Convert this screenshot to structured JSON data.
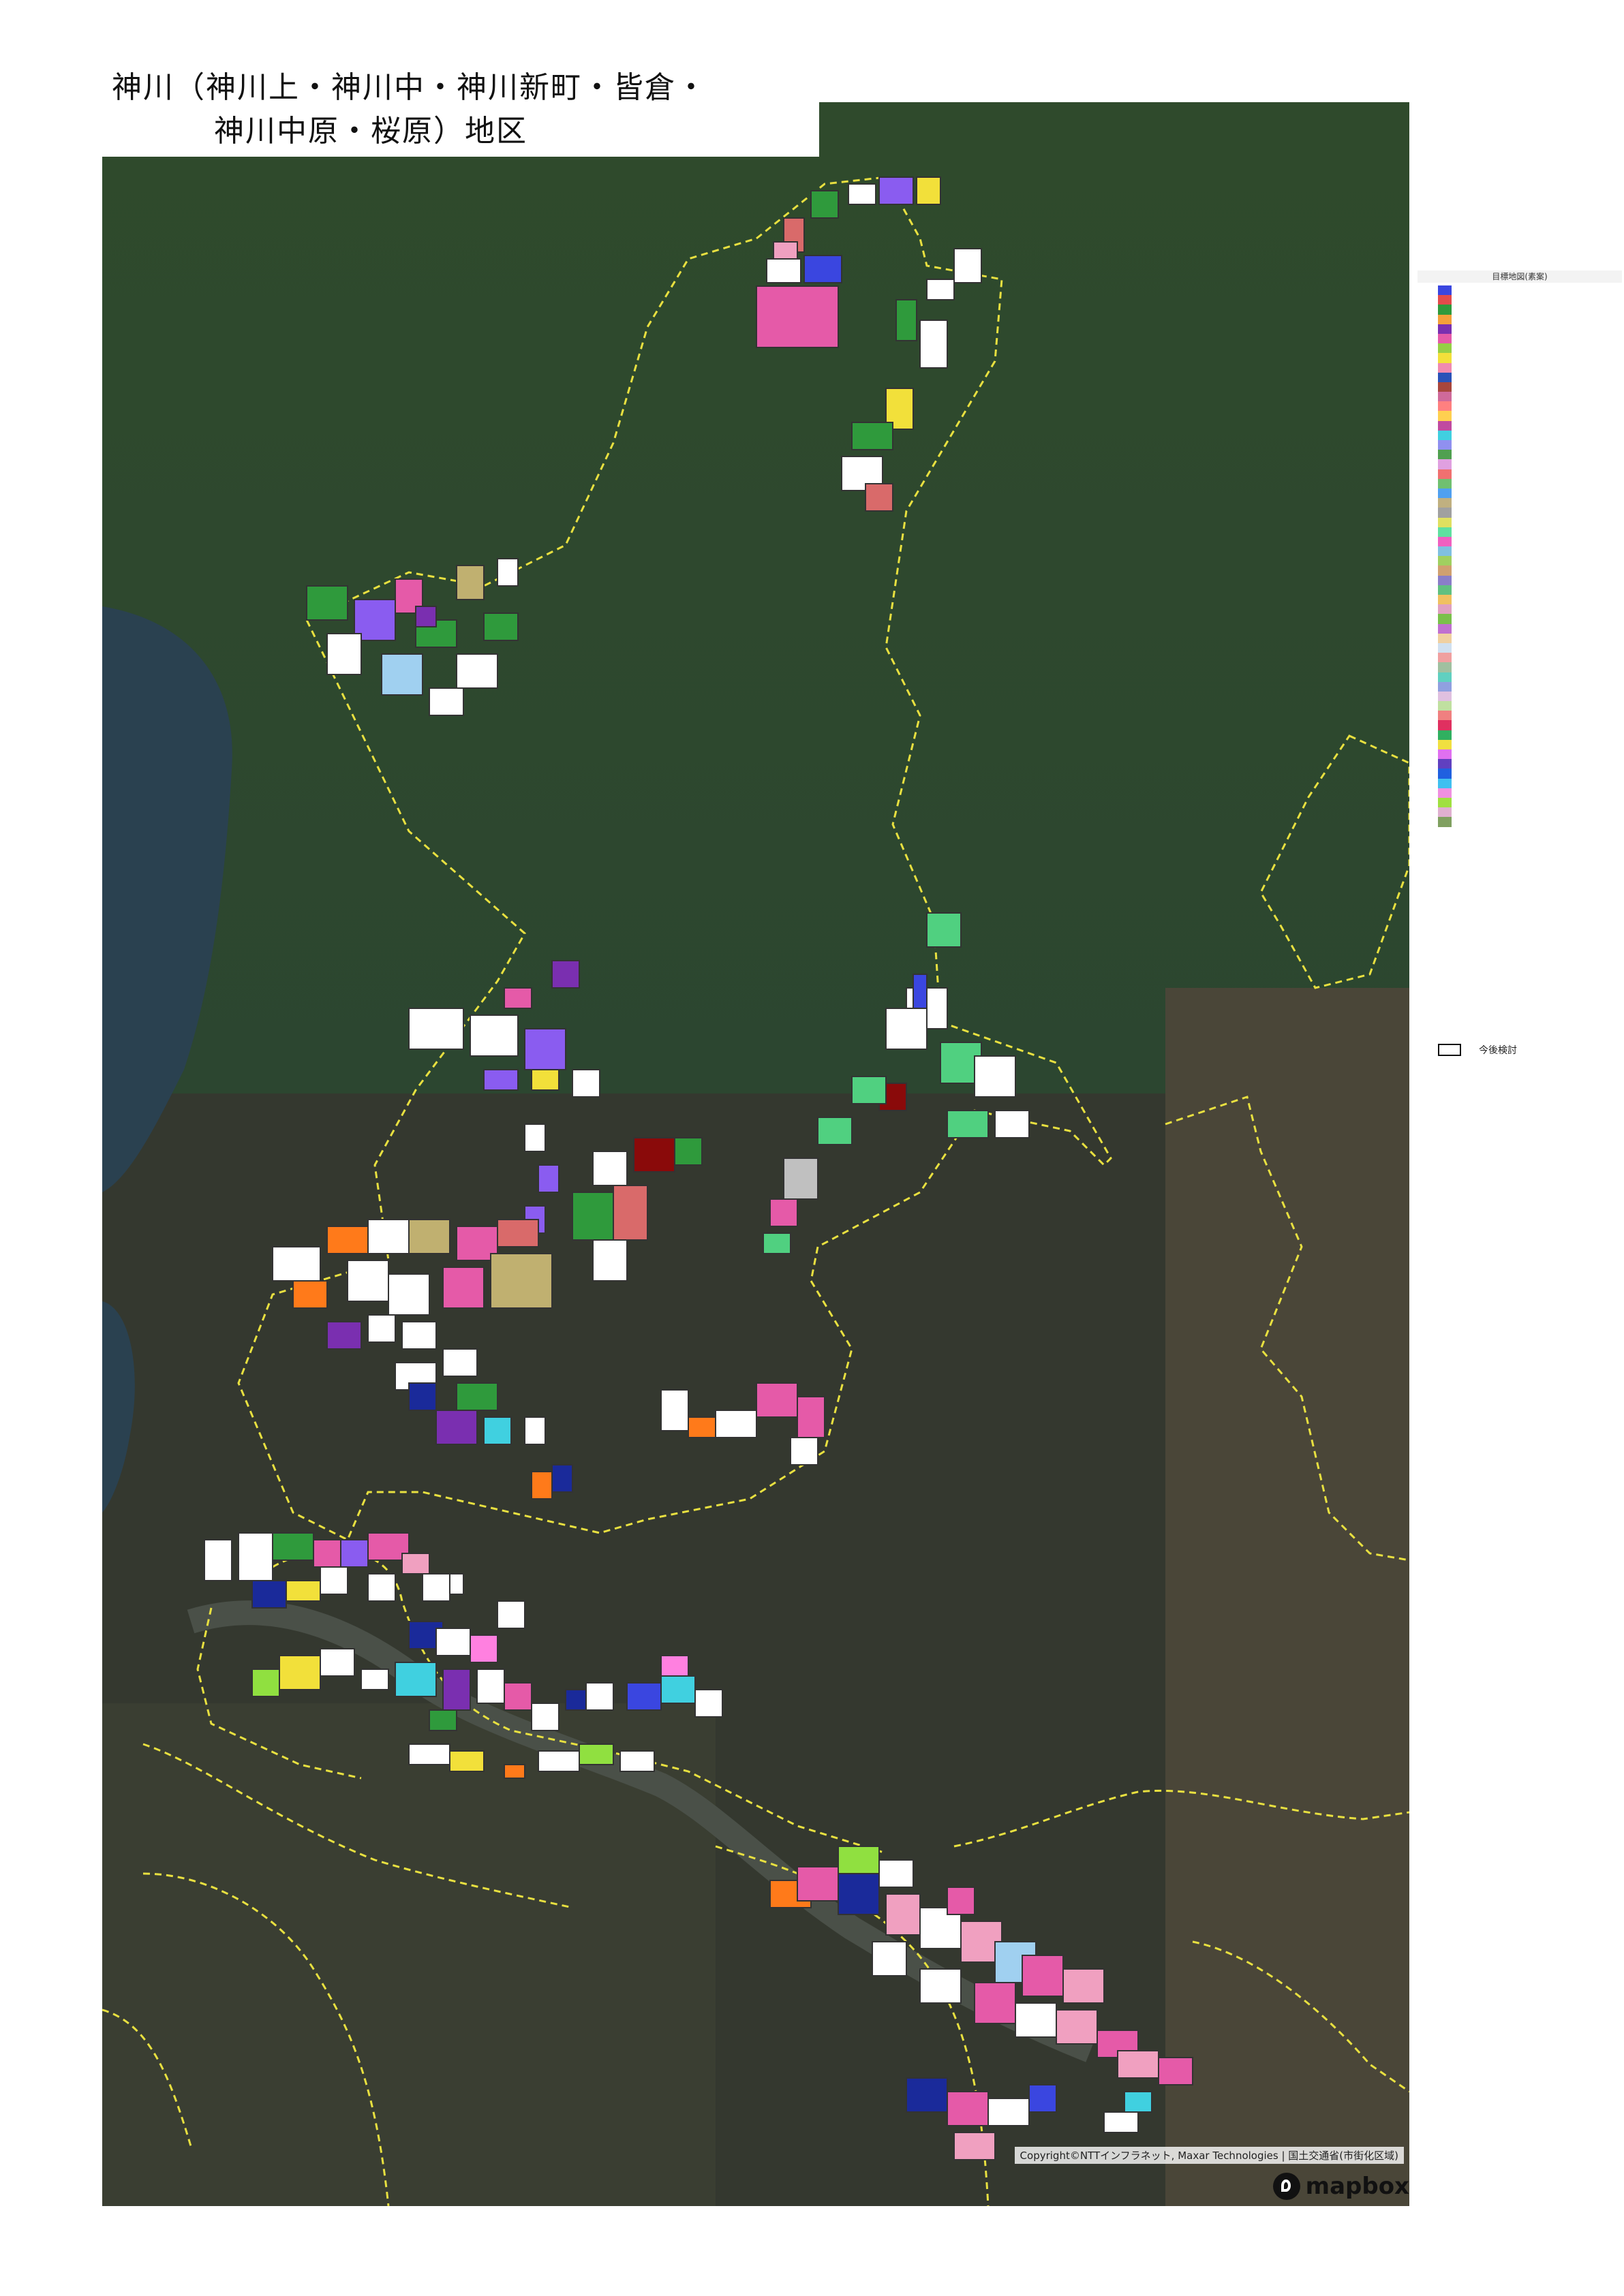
{
  "title": {
    "line1": "神川（神川上・神川中・神川新町・皆倉・",
    "line2": "神川中原・桜原）地区"
  },
  "legend": {
    "header": "目標地図(素案)",
    "review_label": "今後検討",
    "swatches": [
      "#3a46e0",
      "#e34b4b",
      "#2f9a3c",
      "#f3a03a",
      "#7a2fb0",
      "#e55aa8",
      "#96cf45",
      "#f2e03a",
      "#f08ab0",
      "#2a52b8",
      "#a8463c",
      "#cf6a9a",
      "#ff8080",
      "#ffd050",
      "#c04aa0",
      "#40d0e0",
      "#9090f0",
      "#50a050",
      "#e0a0e0",
      "#f07070",
      "#70c070",
      "#50a0f0",
      "#c0b080",
      "#a0a0a0",
      "#e0e060",
      "#60e0a0",
      "#f060c0",
      "#80c0e0",
      "#a0d060",
      "#d0a070",
      "#8a7ec8",
      "#60c080",
      "#f0c060",
      "#e0a0c0",
      "#7ac04a",
      "#c070d0",
      "#f0d0a0",
      "#d0e0f0",
      "#f0a0a0",
      "#a0c0a0",
      "#60d0c0",
      "#90a0e0",
      "#e0c0e0",
      "#c0e0a0",
      "#f08080",
      "#e03060",
      "#30b060",
      "#f0e040",
      "#e070f0",
      "#6040c0",
      "#2060e0",
      "#40c0f0",
      "#f090e0",
      "#a0e040",
      "#e0b0d0",
      "#80a060"
    ]
  },
  "map": {
    "attribution": "Copyright©NTTインフラネット, Maxar Technologies | 国土交通省(市街化区域)",
    "logo_text": "mapbox",
    "boundary_color": "#e8e040",
    "parcel_colors": [
      "#ffffff",
      "#e55aa8",
      "#2f9a3c",
      "#8a5cf0",
      "#f2e03a",
      "#1a2a9a",
      "#ff7a1a",
      "#d96a6a",
      "#c0b070",
      "#7a2fb0",
      "#40d0e0",
      "#f0a0c0",
      "#3a46e0",
      "#8a0a0a",
      "#50d080",
      "#a0d0f0",
      "#90e040",
      "#ff80e0"
    ]
  }
}
